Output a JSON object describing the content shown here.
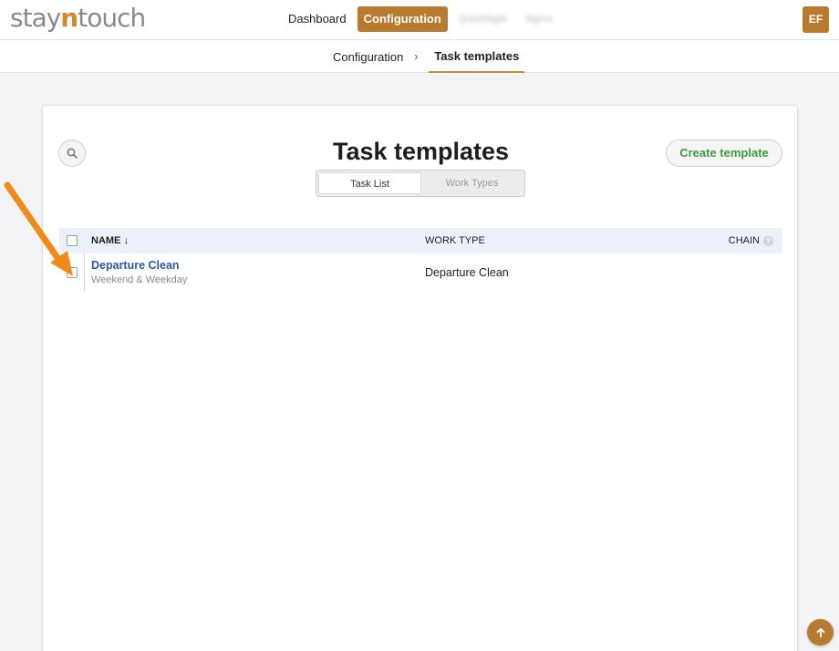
{
  "app": {
    "logo_prefix": "stay",
    "logo_accent": "n",
    "logo_suffix": "touch"
  },
  "nav": {
    "dashboard": "Dashboard",
    "configuration": "Configuration",
    "blurred_1": "QuickSight",
    "blurred_2": "Sigma"
  },
  "user": {
    "initials": "EF"
  },
  "breadcrumb": {
    "parent": "Configuration",
    "separator": "›",
    "current": "Task templates"
  },
  "page": {
    "title": "Task templates",
    "create_button": "Create template",
    "tabs": [
      {
        "label": "Task List",
        "active": true
      },
      {
        "label": "Work Types",
        "active": false
      }
    ]
  },
  "table": {
    "columns": {
      "name": "NAME ↓",
      "work_type": "WORK TYPE",
      "chain": "CHAIN",
      "chain_help": "?"
    },
    "rows": [
      {
        "name": "Departure Clean",
        "schedule": "Weekend & Weekday",
        "work_type": "Departure Clean"
      }
    ]
  },
  "icons": {
    "search": "search-icon",
    "help": "help-icon",
    "scroll_top": "arrow-up-icon",
    "annotation": "orange-arrow-icon"
  },
  "colors": {
    "brand": "#b77a2f",
    "create_text": "#3f9b3f",
    "link": "#2c5aa0",
    "annotation_arrow": "#f28a1a"
  }
}
